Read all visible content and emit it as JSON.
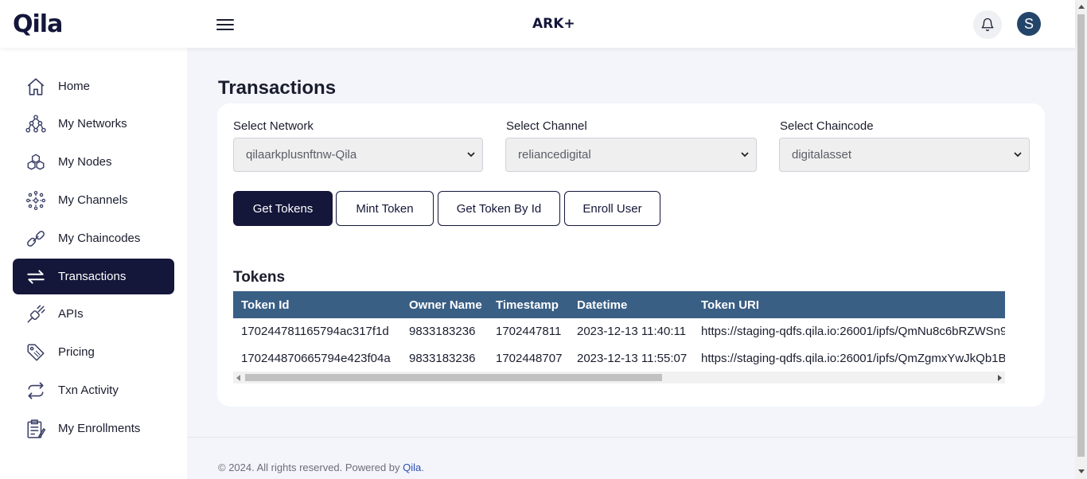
{
  "header": {
    "logo": "Qila",
    "brand": "ARK+",
    "avatar_initial": "S"
  },
  "sidebar": {
    "items": [
      {
        "label": "Home",
        "icon": "home-icon"
      },
      {
        "label": "My Networks",
        "icon": "network-icon"
      },
      {
        "label": "My Nodes",
        "icon": "nodes-icon"
      },
      {
        "label": "My Channels",
        "icon": "channels-icon"
      },
      {
        "label": "My Chaincodes",
        "icon": "chain-link-icon"
      },
      {
        "label": "Transactions",
        "icon": "transfer-arrows-icon",
        "active": true
      },
      {
        "label": "APIs",
        "icon": "api-plug-icon"
      },
      {
        "label": "Pricing",
        "icon": "price-tag-icon"
      },
      {
        "label": "Txn Activity",
        "icon": "activity-arrows-icon"
      },
      {
        "label": "My Enrollments",
        "icon": "clipboard-icon"
      }
    ]
  },
  "main": {
    "title": "Transactions",
    "fields": {
      "network_label": "Select Network",
      "network_value": "qilaarkplusnftnw-Qila",
      "channel_label": "Select Channel",
      "channel_value": "reliancedigital",
      "chaincode_label": "Select Chaincode",
      "chaincode_value": "digitalasset"
    },
    "buttons": {
      "get_tokens": "Get Tokens",
      "mint_token": "Mint Token",
      "get_token_by_id": "Get Token By Id",
      "enroll_user": "Enroll User"
    },
    "section_title": "Tokens",
    "table": {
      "headers": [
        "Token Id",
        "Owner Name",
        "Timestamp",
        "Datetime",
        "Token URI"
      ],
      "rows": [
        [
          "170244781165794ac317f1d",
          "9833183236",
          "1702447811",
          "2023-12-13 11:40:11",
          "https://staging-qdfs.qila.io:26001/ipfs/QmNu8c6bRZWSn9"
        ],
        [
          "170244870665794e423f04a",
          "9833183236",
          "1702448707",
          "2023-12-13 11:55:07",
          "https://staging-qdfs.qila.io:26001/ipfs/QmZgmxYwJkQb1B"
        ]
      ]
    }
  },
  "footer": {
    "text": "© 2024. All rights reserved. Powered by ",
    "link": "Qila",
    "suffix": "."
  },
  "colors": {
    "primary": "#14163a",
    "table_header": "#3a5f85",
    "background": "#f3f5fb"
  }
}
